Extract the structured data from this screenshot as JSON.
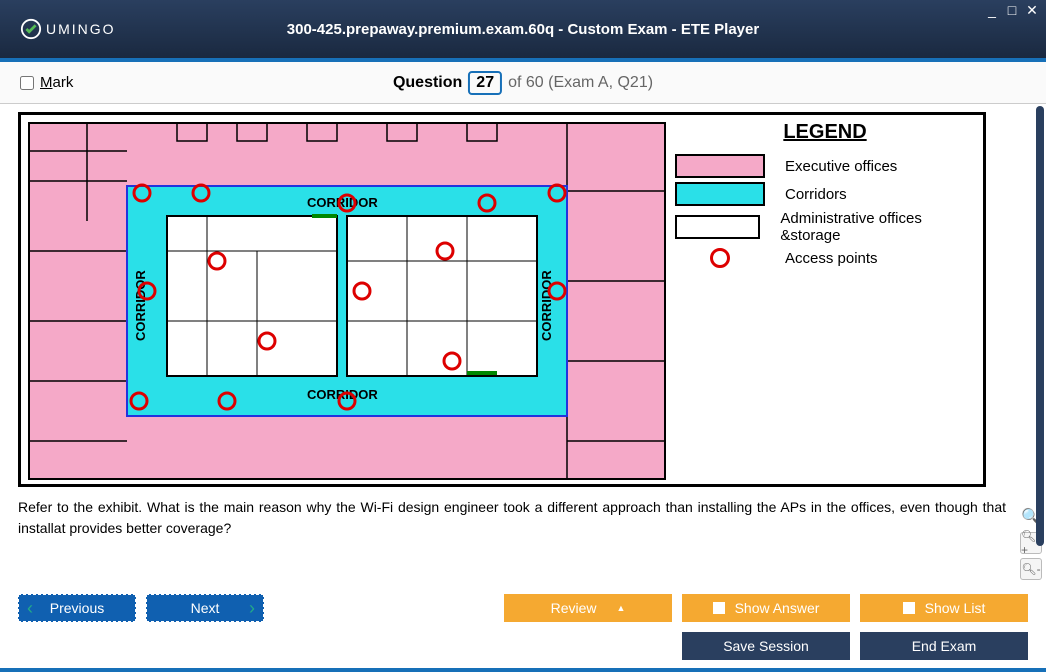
{
  "window": {
    "title": "300-425.prepaway.premium.exam.60q - Custom Exam - ETE Player",
    "logo_text": "UMINGO"
  },
  "question_bar": {
    "mark_label": "Mark",
    "question_label": "Question",
    "question_number": "27",
    "question_rest": "of 60 (Exam A, Q21)"
  },
  "legend": {
    "title": "LEGEND",
    "items": [
      {
        "label": "Executive offices",
        "type": "pink"
      },
      {
        "label": "Corridors",
        "type": "cyan"
      },
      {
        "label": "Administrative offices &storage",
        "type": "white"
      },
      {
        "label": "Access points",
        "type": "circle"
      }
    ]
  },
  "floorplan": {
    "corridor_labels": [
      "CORRIDOR",
      "CORRIDOR",
      "CORRIDOR",
      "CORRIDOR"
    ]
  },
  "question_text": "Refer to the exhibit. What is the main reason why the Wi-Fi design engineer took a different approach than installing the APs in the offices, even though that installat provides better coverage?",
  "buttons": {
    "previous": "Previous",
    "next": "Next",
    "review": "Review",
    "show_answer": "Show Answer",
    "show_list": "Show List",
    "save_session": "Save Session",
    "end_exam": "End Exam"
  }
}
